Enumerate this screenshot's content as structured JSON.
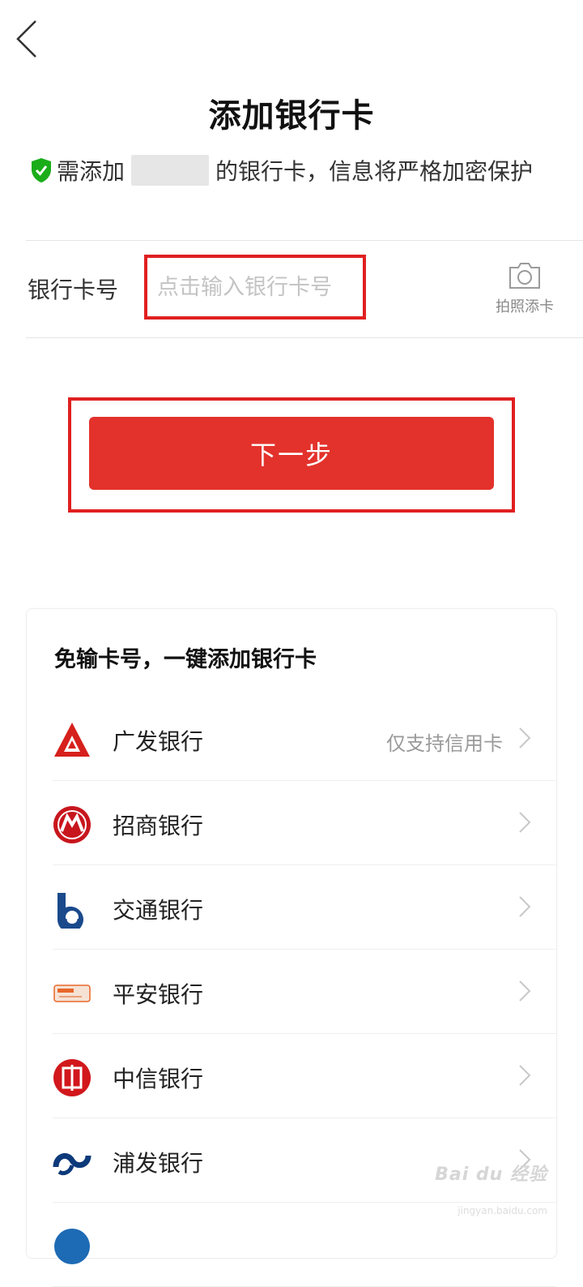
{
  "header": {
    "title": "添加银行卡"
  },
  "notice": {
    "prefix": "需添加",
    "suffix": "的银行卡，信息将严格加密保护",
    "icon": "shield-check-icon",
    "icon_color": "#1aad19"
  },
  "form": {
    "card_label": "银行卡号",
    "card_placeholder": "点击输入银行卡号",
    "card_value": "",
    "photo_label": "拍照添卡"
  },
  "next_button": {
    "label": "下一步",
    "color": "#e3322b"
  },
  "quick_add": {
    "title": "免输卡号，一键添加银行卡",
    "banks": [
      {
        "name": "广发银行",
        "note": "仅支持信用卡",
        "icon": "cgb-logo-icon"
      },
      {
        "name": "招商银行",
        "note": "",
        "icon": "cmb-logo-icon"
      },
      {
        "name": "交通银行",
        "note": "",
        "icon": "bocom-logo-icon"
      },
      {
        "name": "平安银行",
        "note": "",
        "icon": "pingan-logo-icon"
      },
      {
        "name": "中信银行",
        "note": "",
        "icon": "citic-logo-icon"
      },
      {
        "name": "浦发银行",
        "note": "",
        "icon": "spdb-logo-icon"
      },
      {
        "name": "",
        "note": "",
        "icon": "bank-logo-icon"
      }
    ]
  },
  "colors": {
    "highlight_border": "#e02020",
    "primary_red": "#e3322b"
  },
  "watermark": {
    "brand": "Bai du 经验",
    "url": "jingyan.baidu.com"
  }
}
